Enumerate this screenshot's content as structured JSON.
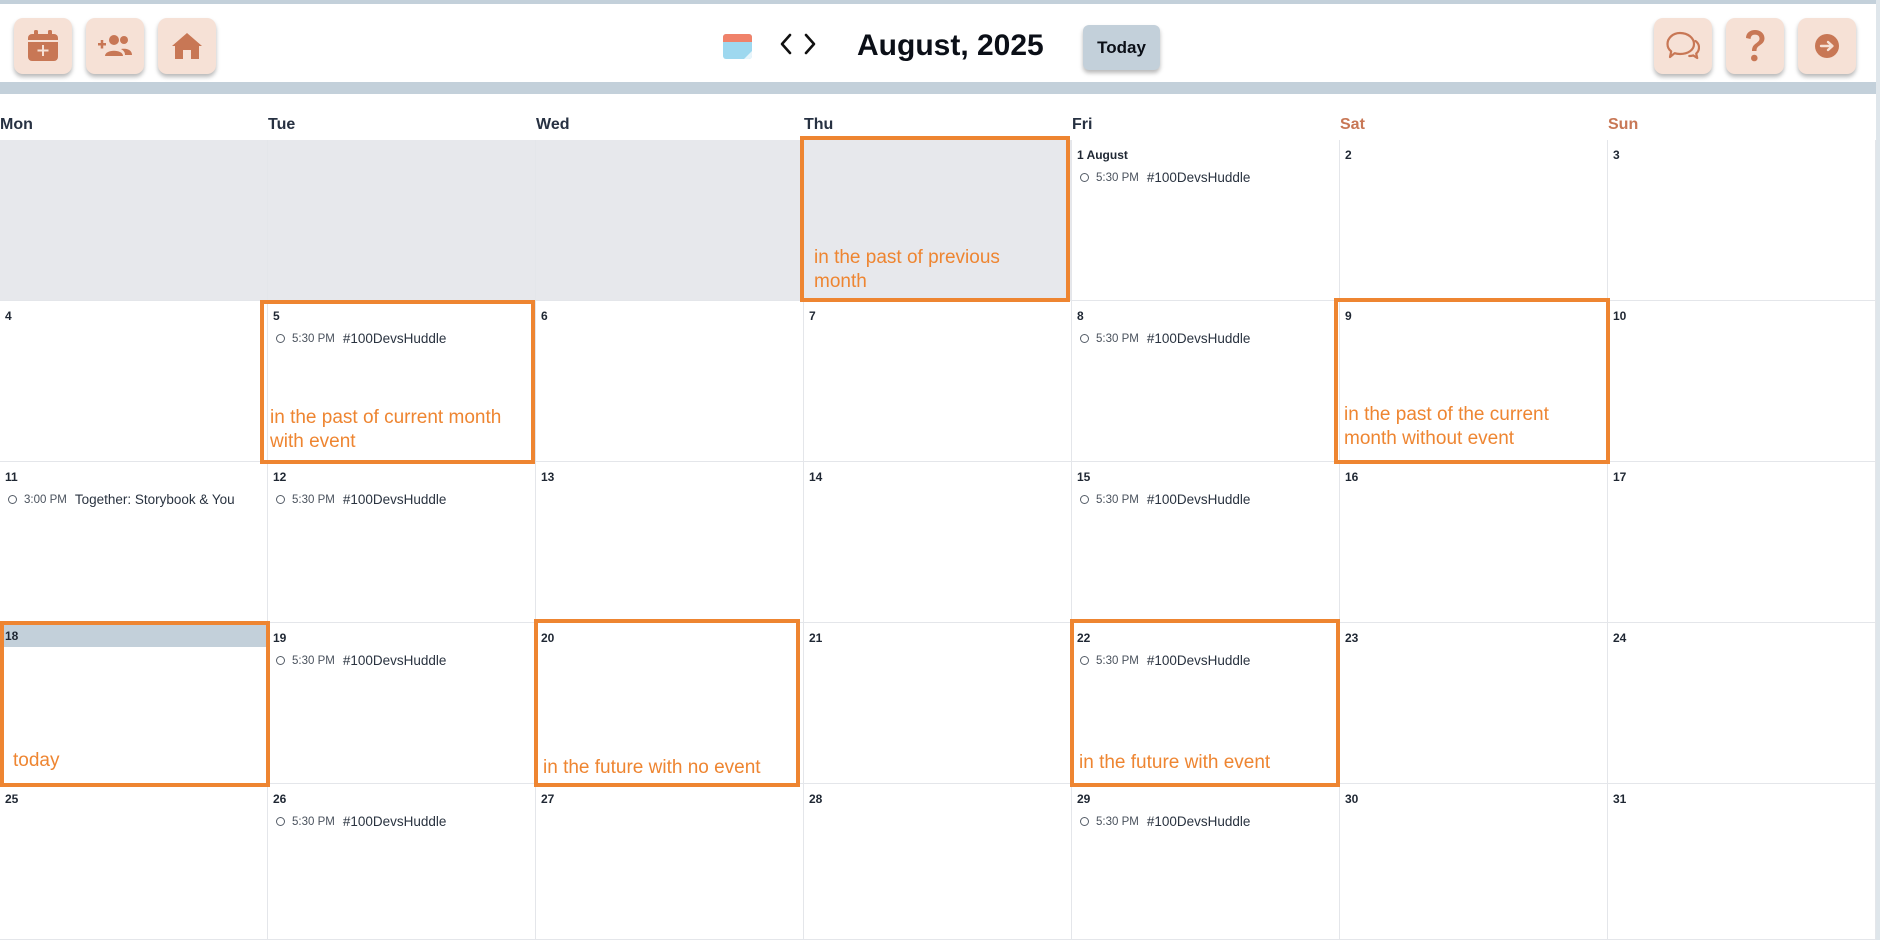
{
  "header": {
    "title": "August, 2025",
    "today_label": "Today",
    "left_buttons": [
      {
        "name": "add-event-button",
        "icon": "calendar-plus-icon"
      },
      {
        "name": "add-people-button",
        "icon": "user-plus-icon"
      },
      {
        "name": "home-button",
        "icon": "home-icon"
      }
    ],
    "right_buttons": [
      {
        "name": "chat-button",
        "icon": "chat-bubbles-icon"
      },
      {
        "name": "help-button",
        "icon": "question-mark-icon"
      },
      {
        "name": "logout-button",
        "icon": "arrow-right-circle-icon"
      }
    ],
    "colors": {
      "accent": "#c87755",
      "button_bg": "#f6e1d6",
      "today_bg": "#c3d0da"
    }
  },
  "weekdays": [
    "Mon",
    "Tue",
    "Wed",
    "Thu",
    "Fri",
    "Sat",
    "Sun"
  ],
  "weekend_color": "#c87755",
  "days": [
    {
      "label": "",
      "prev": true
    },
    {
      "label": "",
      "prev": true
    },
    {
      "label": "",
      "prev": true
    },
    {
      "label": "",
      "prev": true
    },
    {
      "label": "1 August",
      "event": {
        "time": "5:30 PM",
        "title": "#100DevsHuddle"
      }
    },
    {
      "label": "2"
    },
    {
      "label": "3"
    },
    {
      "label": "4"
    },
    {
      "label": "5",
      "event": {
        "time": "5:30 PM",
        "title": "#100DevsHuddle"
      }
    },
    {
      "label": "6"
    },
    {
      "label": "7"
    },
    {
      "label": "8",
      "event": {
        "time": "5:30 PM",
        "title": "#100DevsHuddle"
      }
    },
    {
      "label": "9"
    },
    {
      "label": "10"
    },
    {
      "label": "11",
      "event": {
        "time": "3:00 PM",
        "title": "Together: Storybook & You"
      }
    },
    {
      "label": "12",
      "event": {
        "time": "5:30 PM",
        "title": "#100DevsHuddle"
      }
    },
    {
      "label": "13"
    },
    {
      "label": "14"
    },
    {
      "label": "15",
      "event": {
        "time": "5:30 PM",
        "title": "#100DevsHuddle"
      }
    },
    {
      "label": "16"
    },
    {
      "label": "17"
    },
    {
      "label": "18",
      "today": true
    },
    {
      "label": "19",
      "event": {
        "time": "5:30 PM",
        "title": "#100DevsHuddle"
      }
    },
    {
      "label": "20"
    },
    {
      "label": "21"
    },
    {
      "label": "22",
      "event": {
        "time": "5:30 PM",
        "title": "#100DevsHuddle"
      }
    },
    {
      "label": "23"
    },
    {
      "label": "24"
    },
    {
      "label": "25"
    },
    {
      "label": "26",
      "event": {
        "time": "5:30 PM",
        "title": "#100DevsHuddle"
      }
    },
    {
      "label": "27"
    },
    {
      "label": "28"
    },
    {
      "label": "29",
      "event": {
        "time": "5:30 PM",
        "title": "#100DevsHuddle"
      }
    },
    {
      "label": "30"
    },
    {
      "label": "31"
    }
  ],
  "annotations": {
    "color": "#ee8531",
    "prev_month": "in the past of previous month",
    "past_with_event": "in the past of current month with event",
    "past_without_event": "in the past of the current month without event",
    "today": "today",
    "future_no_event": "in the future with no event",
    "future_with_event": "in the future with event"
  }
}
